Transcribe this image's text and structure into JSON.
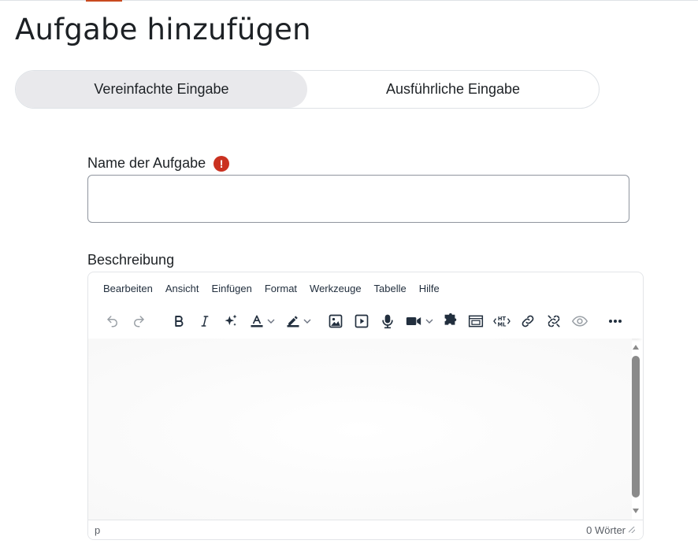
{
  "page": {
    "title": "Aufgabe hinzufügen"
  },
  "mode_toggle": {
    "simple_label": "Vereinfachte Eingabe",
    "detailed_label": "Ausführliche Eingabe",
    "active": "simple"
  },
  "form": {
    "name_label": "Name der Aufgabe",
    "required_mark": "!",
    "name_value": "",
    "description_label": "Beschreibung"
  },
  "editor": {
    "menu": [
      "Bearbeiten",
      "Ansicht",
      "Einfügen",
      "Format",
      "Werkzeuge",
      "Tabelle",
      "Hilfe"
    ],
    "toolbar_icons": [
      "undo-icon",
      "redo-icon",
      "bold-icon",
      "italic-icon",
      "ai-sparkle-icon",
      "text-color-icon",
      "highlight-color-icon",
      "image-icon",
      "media-icon",
      "microphone-icon",
      "video-camera-icon",
      "puzzle-icon",
      "embed-icon",
      "html-icon",
      "link-icon",
      "unlink-icon",
      "preview-icon",
      "more-icon"
    ],
    "status_path": "p",
    "word_count": "0 Wörter"
  },
  "colors": {
    "required": "#ca3120",
    "accent": "#c94a1f",
    "toggle_active_bg": "#e9e9ec",
    "text": "#1d2125"
  }
}
